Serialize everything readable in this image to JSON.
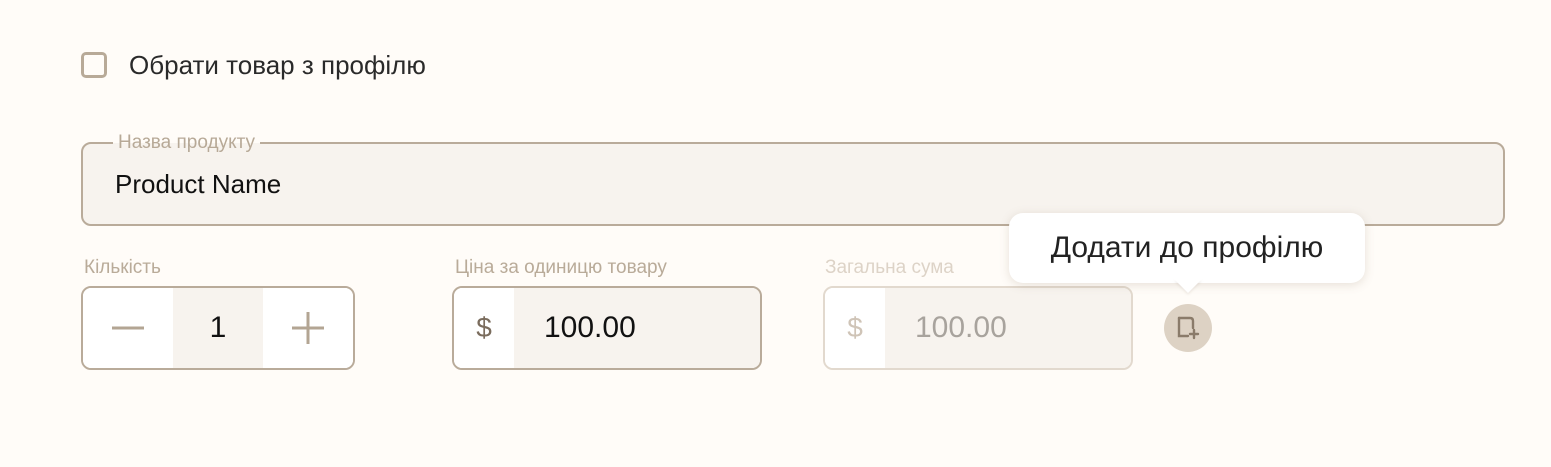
{
  "select_from_profile": {
    "label": "Обрати товар з профілю",
    "checked": false
  },
  "product_name": {
    "label": "Назва продукту",
    "value": "Product Name"
  },
  "quantity": {
    "label": "Кількість",
    "value": "1",
    "decrement_icon": "minus-icon",
    "increment_icon": "plus-icon"
  },
  "unit_price": {
    "label": "Ціна за одиницю товару",
    "currency": "$",
    "value": "100.00"
  },
  "total": {
    "label": "Загальна сума",
    "currency": "$",
    "value": "100.00",
    "disabled": true
  },
  "add_to_profile": {
    "icon": "document-add-icon",
    "tooltip": "Додати до профілю"
  },
  "colors": {
    "background": "#fffcf8",
    "border": "#b9ab9a",
    "field_fill": "#f7f3ee",
    "label": "#b9ab99",
    "icon_button": "#ddd2c4"
  }
}
